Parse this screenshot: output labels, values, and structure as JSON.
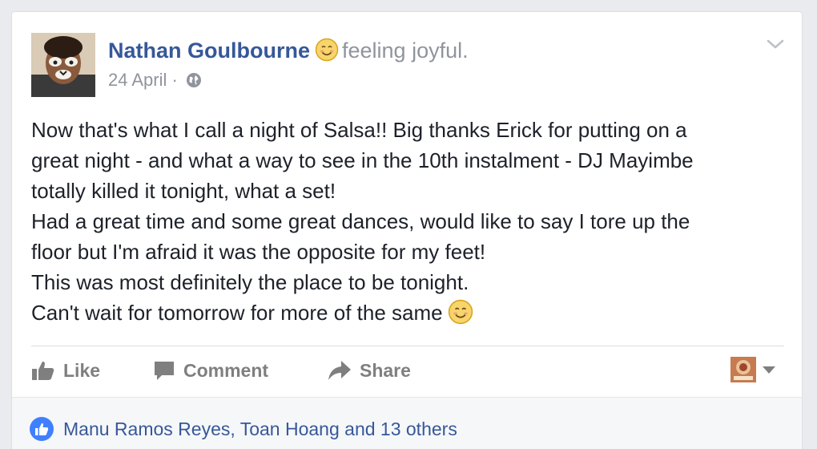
{
  "post": {
    "author": "Nathan Goulbourne",
    "feeling_text": "feeling joyful.",
    "date": "24 April",
    "separator": "·",
    "privacy_icon": "globe-icon",
    "body_lines": [
      "Now that's what I call a night of Salsa!! Big thanks Erick for putting on a",
      "great night - and what a way to see in the 10th instalment - DJ Mayimbe",
      "totally killed it tonight, what a set!",
      "Had a great time and some great dances, would like to say I tore up the",
      "floor but I'm afraid it was the opposite for my feet!",
      "This was most definitely the place to be tonight.",
      "Can't wait for tomorrow for more of the same"
    ]
  },
  "actions": {
    "like_label": "Like",
    "comment_label": "Comment",
    "share_label": "Share"
  },
  "reactions": {
    "text": "Manu Ramos Reyes, Toan Hoang and 13 others"
  },
  "colors": {
    "link": "#365899",
    "muted": "#90949c",
    "action": "#7f7f7f",
    "like_badge": "#4080ff",
    "background": "#e9ebee"
  }
}
